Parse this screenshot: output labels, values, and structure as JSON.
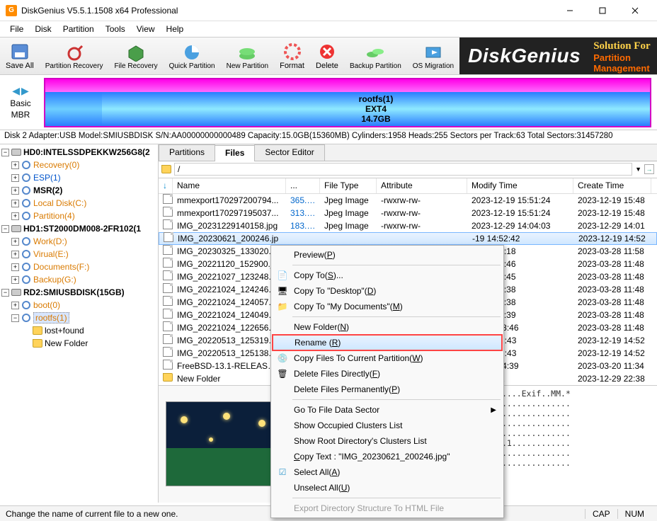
{
  "window": {
    "title": "DiskGenius V5.5.1.1508 x64 Professional"
  },
  "menu": [
    "File",
    "Disk",
    "Partition",
    "Tools",
    "View",
    "Help"
  ],
  "toolbar": [
    {
      "label": "Save All",
      "name": "save-all"
    },
    {
      "label": "Partition Recovery",
      "name": "partition-recovery"
    },
    {
      "label": "File Recovery",
      "name": "file-recovery"
    },
    {
      "label": "Quick Partition",
      "name": "quick-partition"
    },
    {
      "label": "New Partition",
      "name": "new-partition"
    },
    {
      "label": "Format",
      "name": "format"
    },
    {
      "label": "Delete",
      "name": "delete"
    },
    {
      "label": "Backup Partition",
      "name": "backup-partition"
    },
    {
      "label": "OS Migration",
      "name": "os-migration"
    }
  ],
  "banner": {
    "logo": "DiskGenius",
    "line1": "All-In-One Solution For",
    "line2": "Partition Management & Data R"
  },
  "diskmap": {
    "nav": {
      "mode": "Basic",
      "mbr": "MBR"
    },
    "part": {
      "name": "rootfs(1)",
      "fs": "EXT4",
      "size": "14.7GB"
    }
  },
  "diskinfo": "Disk 2 Adapter:USB  Model:SMIUSBDISK  S/N:AA00000000000489  Capacity:15.0GB(15360MB)  Cylinders:1958  Heads:255  Sectors per Track:63  Total Sectors:31457280",
  "tree": {
    "d0": "HD0:INTELSSDPEKKW256G8(2",
    "d0c": [
      "Recovery(0)",
      "ESP(1)",
      "MSR(2)",
      "Local Disk(C:)",
      "Partition(4)"
    ],
    "d1": "HD1:ST2000DM008-2FR102(1",
    "d1c": [
      "Work(D:)",
      "Virual(E:)",
      "Documents(F:)",
      "Backup(G:)"
    ],
    "d2": "RD2:SMIUSBDISK(15GB)",
    "d2c": [
      "boot(0)",
      "rootfs(1)"
    ],
    "d2cc": [
      "lost+found",
      "New Folder"
    ]
  },
  "tabs": [
    "Partitions",
    "Files",
    "Sector Editor"
  ],
  "path": "/",
  "columns": [
    "Name",
    "...",
    "File Type",
    "Attribute",
    "Modify Time",
    "Create Time"
  ],
  "files": [
    {
      "n": "mmexport170297200794...",
      "s": "365.5...",
      "t": "Jpeg Image",
      "a": "-rwxrw-rw-",
      "m": "2023-12-19 15:51:24",
      "c": "2023-12-19 15:48"
    },
    {
      "n": "mmexport170297195037...",
      "s": "313.5...",
      "t": "Jpeg Image",
      "a": "-rwxrw-rw-",
      "m": "2023-12-19 15:51:24",
      "c": "2023-12-19 15:48"
    },
    {
      "n": "IMG_20231229140158.jpg",
      "s": "183.9...",
      "t": "Jpeg Image",
      "a": "-rwxrw-rw-",
      "m": "2023-12-29 14:04:03",
      "c": "2023-12-29 14:01"
    },
    {
      "n": "IMG_20230621_200246.jp",
      "s": "",
      "t": "",
      "a": "",
      "m": "-19 14:52:42",
      "c": "2023-12-19 14:52"
    },
    {
      "n": "IMG_20230325_133020.jp",
      "s": "",
      "t": "",
      "a": "",
      "m": "28 11:58:18",
      "c": "2023-03-28 11:58"
    },
    {
      "n": "IMG_20221120_152900.jp",
      "s": "",
      "t": "",
      "a": "",
      "m": "28 11:48:46",
      "c": "2023-03-28 11:48"
    },
    {
      "n": "IMG_20221027_123248.jp",
      "s": "",
      "t": "",
      "a": "",
      "m": "28 11:48:45",
      "c": "2023-03-28 11:48"
    },
    {
      "n": "IMG_20221024_124246.jp",
      "s": "",
      "t": "",
      "a": "",
      "m": "28 11:48:38",
      "c": "2023-03-28 11:48"
    },
    {
      "n": "IMG_20221024_124057.jp",
      "s": "",
      "t": "",
      "a": "",
      "m": "28 11:48:38",
      "c": "2023-03-28 11:48"
    },
    {
      "n": "IMG_20221024_124049.jp",
      "s": "",
      "t": "",
      "a": "",
      "m": "28 11:48:39",
      "c": "2023-03-28 11:48"
    },
    {
      "n": "IMG_20221024_122656.jp",
      "s": "",
      "t": "",
      "a": "",
      "m": "-28 11:48:46",
      "c": "2023-03-28 11:48"
    },
    {
      "n": "IMG_20220513_125319.jp",
      "s": "",
      "t": "",
      "a": "",
      "m": "19 14:52:43",
      "c": "2023-12-19 14:52"
    },
    {
      "n": "IMG_20220513_125138.jp",
      "s": "",
      "t": "",
      "a": "",
      "m": "19 14:52:43",
      "c": "2023-12-19 14:52"
    },
    {
      "n": "FreeBSD-13.1-RELEASE-...",
      "s": "",
      "t": "",
      "a": "",
      "m": "-09 11:34:39",
      "c": "2023-03-20 11:34"
    },
    {
      "n": "New Folder",
      "s": "",
      "t": "",
      "a": "",
      "m": "14:33:32",
      "c": "2023-12-29 22:38",
      "folder": true
    }
  ],
  "ctx": {
    "preview": "Preview(P)",
    "copyto": "Copy To(S)...",
    "copydesk": "Copy To \"Desktop\"(D)",
    "copydocs": "Copy To \"My Documents\"(M)",
    "newfolder": "New Folder(N)",
    "rename": "Rename (R)",
    "copycur": "Copy Files To Current Partition(W)",
    "deldirect": "Delete Files Directly(F)",
    "delperm": "Delete Files Permanently(P)",
    "gotosec": "Go To File Data Sector",
    "occclust": "Show Occupied Clusters List",
    "rootclust": "Show Root Directory's Clusters List",
    "copytext": "Copy Text : \"IMG_20230621_200246.jpg\"",
    "selall": "Select All(A)",
    "unselall": "Unselect All(U)",
    "export": "Export Directory Structure To HTML File"
  },
  "hex": [
    "00 2A   .....Exif..MM.*",
    "10 00   ...............",
    "02 02   ...............",
    "01 1A   ...............",
    "50 00   ...............",
    "01 32   ..1............",
    "08 00   ...............",
    "00 00   ..............."
  ],
  "status": {
    "msg": "Change the name of current file to a new one.",
    "cap": "CAP",
    "num": "NUM"
  }
}
